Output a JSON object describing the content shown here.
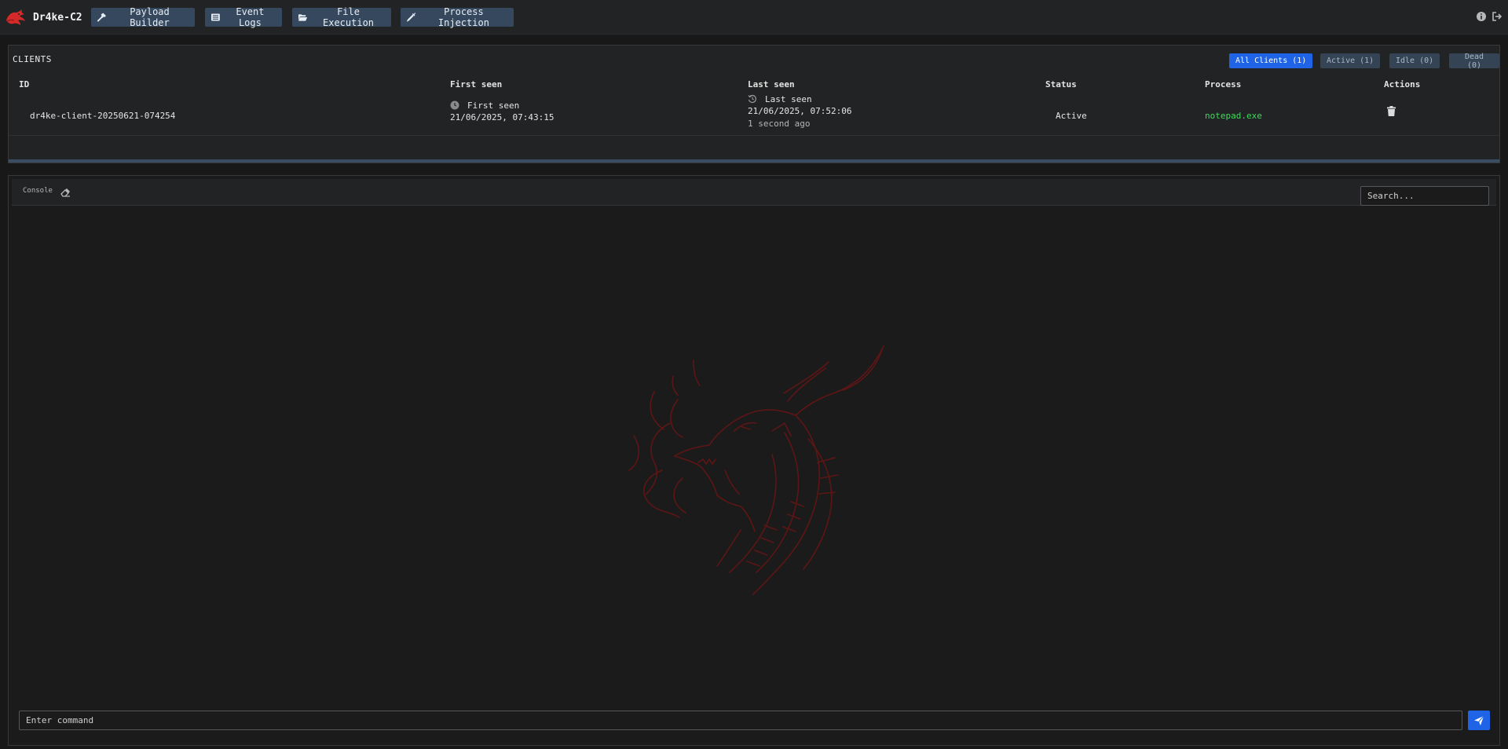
{
  "app": {
    "name": "Dr4ke-C2",
    "brand_color": "#d42a2a"
  },
  "nav": {
    "buttons": [
      {
        "label": "Payload Builder",
        "icon": "hammer-icon"
      },
      {
        "label": "Event Logs",
        "icon": "list-icon"
      },
      {
        "label": "File Execution",
        "icon": "folder-open-icon"
      },
      {
        "label": "Process Injection",
        "icon": "syringe-icon"
      }
    ],
    "right_icons": [
      "info-icon",
      "logout-icon"
    ]
  },
  "clients": {
    "title": "CLIENTS",
    "filters": [
      {
        "label": "All Clients (1)",
        "active": true
      },
      {
        "label": "Active (1)",
        "active": false
      },
      {
        "label": "Idle (0)",
        "active": false
      },
      {
        "label": "Dead (0)",
        "active": false
      }
    ],
    "columns": [
      "ID",
      "First seen",
      "Last seen",
      "Status",
      "Process",
      "Actions"
    ],
    "rows": [
      {
        "id": "dr4ke-client-20250621-074254",
        "first_seen_label": "First seen",
        "first_seen": "21/06/2025, 07:43:15",
        "last_seen_label": "Last seen",
        "last_seen": "21/06/2025, 07:52:06",
        "last_seen_relative": "1 second ago",
        "status": "Active",
        "process": "notepad.exe",
        "action_icon": "trash-icon"
      }
    ]
  },
  "console": {
    "tab_label": "Console",
    "search_placeholder": "Search...",
    "command_placeholder": "Enter command",
    "accent": "#1f63e6"
  }
}
